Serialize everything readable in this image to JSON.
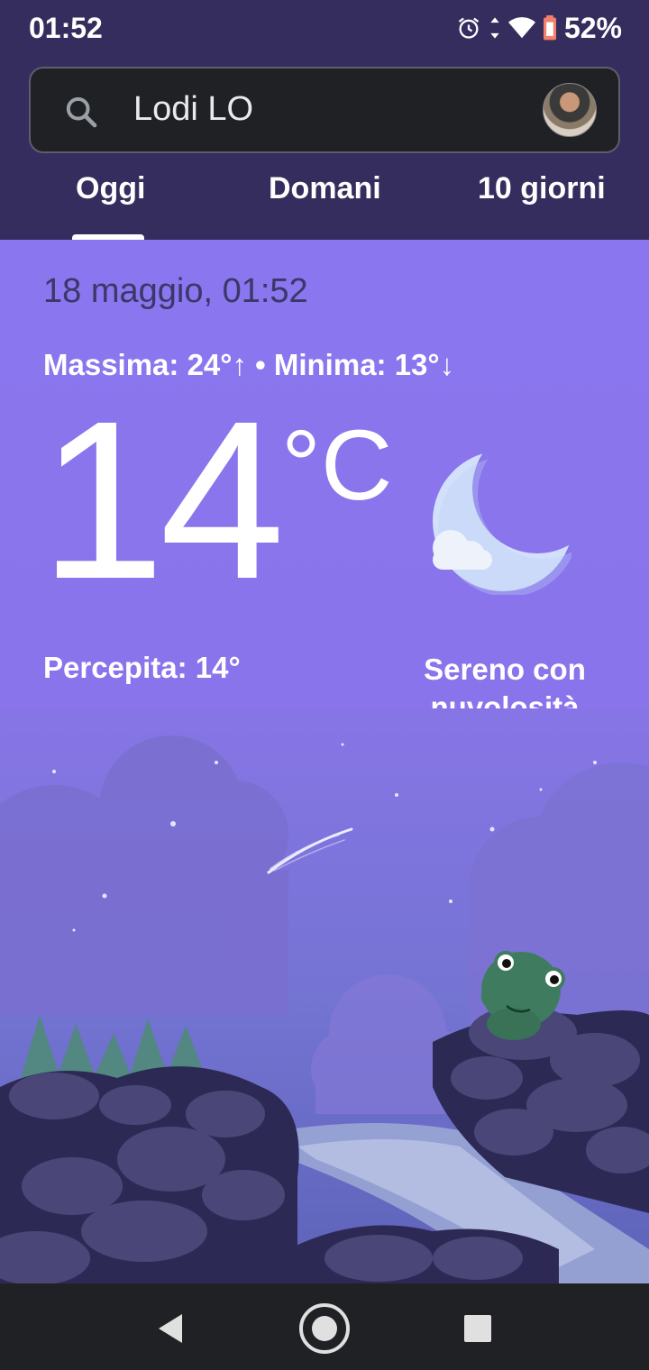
{
  "status_bar": {
    "time": "01:52",
    "battery": "52%",
    "icons": [
      "alarm-icon",
      "data-arrows-icon",
      "wifi-icon",
      "battery-icon"
    ]
  },
  "search": {
    "location": "Lodi LO"
  },
  "tabs": [
    {
      "label": "Oggi",
      "selected": true
    },
    {
      "label": "Domani",
      "selected": false
    },
    {
      "label": "10 giorni",
      "selected": false
    }
  ],
  "weather": {
    "date": "18 maggio, 01:52",
    "minmax": "Massima: 24°↑ • Minima: 13°↓",
    "temperature": "14",
    "unit": "°C",
    "feels_like": "Percepita: 14°",
    "condition": "Sereno con nuvolosità sparsa",
    "icon": "moon-cloud-icon"
  },
  "colors": {
    "header_bg": "#352d5e",
    "main_bg": "#8a76ee",
    "search_bg": "#202124",
    "nav_bg": "#202124"
  }
}
